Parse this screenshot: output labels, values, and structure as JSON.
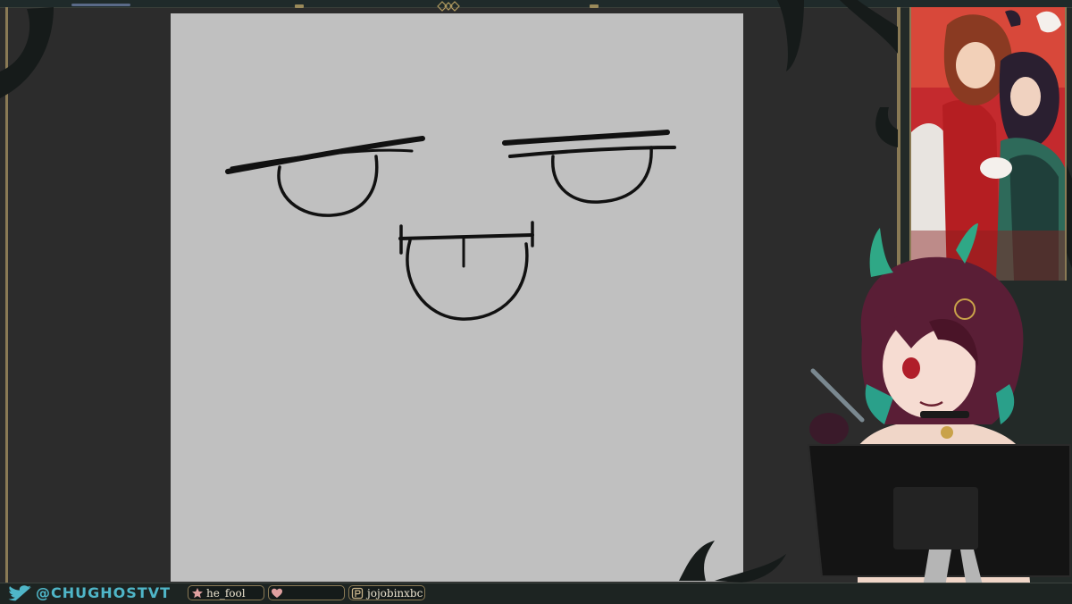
{
  "social": {
    "twitter_handle": "@CHUGHOSTVT",
    "icon": "twitter-bird-icon"
  },
  "alerts": {
    "follower": {
      "icon": "star-icon",
      "name": "he_fool"
    },
    "donation": {
      "icon": "heart-icon",
      "name": ""
    },
    "subscriber": {
      "icon": "patreon-icon",
      "name": "jojobinxbc"
    }
  },
  "colors": {
    "canvas": "#c0c0c0",
    "frame_gold": "#8a7a55",
    "handle_teal": "#4fb6c8",
    "art_red": "#b8262c"
  }
}
